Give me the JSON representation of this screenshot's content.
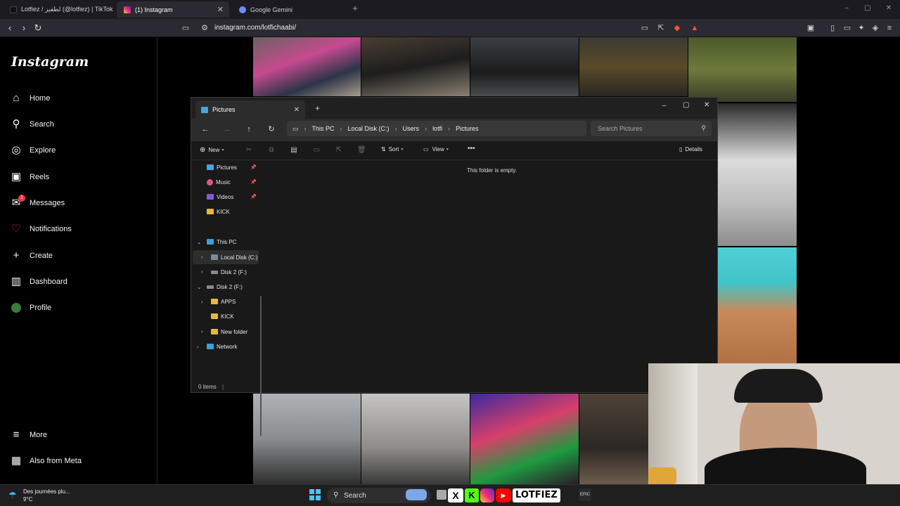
{
  "browser": {
    "tabs": [
      {
        "label": "Lotfiez / لطفيز (@lotfiez) | TikTok",
        "active": false
      },
      {
        "label": "(1) Instagram",
        "active": true
      },
      {
        "label": "Google Gemini",
        "active": false
      }
    ],
    "url": "instagram.com/lotfichaabi/",
    "notification_count": "1"
  },
  "instagram": {
    "logo": "Instagram",
    "nav": [
      {
        "label": "Home",
        "icon": "home-icon"
      },
      {
        "label": "Search",
        "icon": "search-icon"
      },
      {
        "label": "Explore",
        "icon": "compass-icon"
      },
      {
        "label": "Reels",
        "icon": "reels-icon"
      },
      {
        "label": "Messages",
        "icon": "messenger-icon",
        "badge": "1"
      },
      {
        "label": "Notifications",
        "icon": "heart-icon"
      },
      {
        "label": "Create",
        "icon": "plus-icon"
      },
      {
        "label": "Dashboard",
        "icon": "dashboard-icon"
      },
      {
        "label": "Profile",
        "icon": "avatar-icon"
      }
    ],
    "bottom_nav": [
      {
        "label": "More",
        "icon": "menu-icon"
      },
      {
        "label": "Also from Meta",
        "icon": "meta-icon"
      }
    ]
  },
  "explorer": {
    "tab_title": "Pictures",
    "breadcrumb": [
      "This PC",
      "Local Disk (C:)",
      "Users",
      "lotfi",
      "Pictures"
    ],
    "search_placeholder": "Search Pictures",
    "commands": {
      "new": "New",
      "sort": "Sort",
      "view": "View",
      "details": "Details"
    },
    "quick_access": [
      "Pictures",
      "Music",
      "Videos",
      "KICK"
    ],
    "tree": {
      "this_pc": "This PC",
      "local_disk": "Local Disk (C:)",
      "disk2": "Disk 2 (F:)",
      "disk2_expanded": "Disk 2 (F:)",
      "apps": "APPS",
      "kick": "KICK",
      "new_folder": "New folder",
      "network": "Network"
    },
    "empty_message": "This folder is empty.",
    "status": "0 items"
  },
  "taskbar": {
    "weather_text": "Des journées plu...",
    "temperature": "9°C",
    "search_label": "Search",
    "overlay_text": "LOTFIEZ"
  },
  "colors": {
    "instagram_badge": "#ff3040",
    "explorer_bg": "#191919",
    "folder_yellow": "#e8b83a"
  }
}
